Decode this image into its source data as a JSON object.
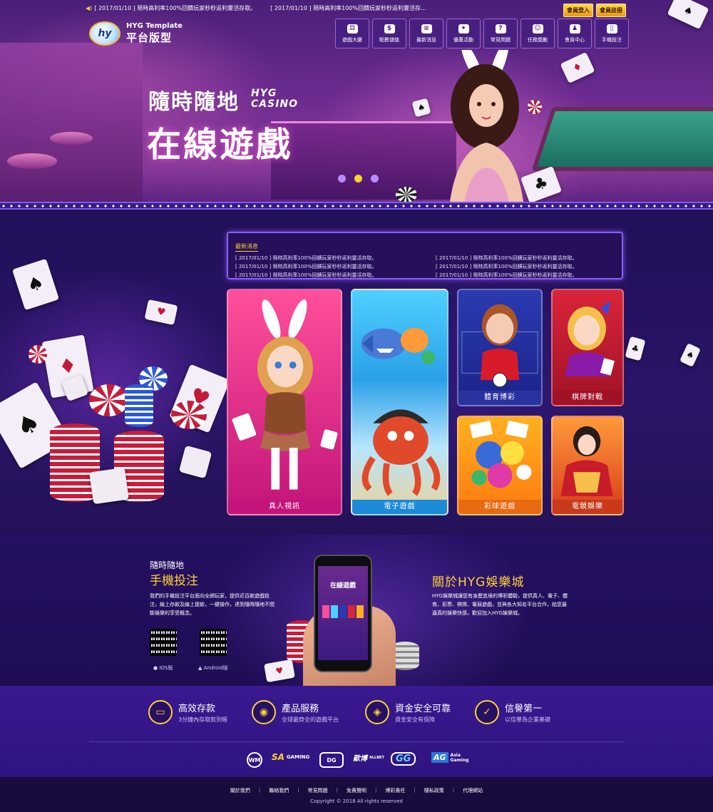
{
  "top_bar": {
    "ticker": [
      "[ 2017/01/10 ]  限時高利率100%回饋玩家秒秒返利靈活存取。",
      "[ 2017/01/10 ]  限時高利率100%回饋玩家秒秒返利靈活存..."
    ],
    "login_label": "會員登入",
    "register_label": "會員註冊"
  },
  "logo": {
    "mark": "hy",
    "line1": "HYG Template",
    "line2": "平台版型"
  },
  "nav": [
    {
      "label": "遊戲大廳",
      "icon": "dice-icon"
    },
    {
      "label": "點數儲值",
      "icon": "deposit-icon"
    },
    {
      "label": "最新消息",
      "icon": "news-icon"
    },
    {
      "label": "優惠活動",
      "icon": "gift-icon"
    },
    {
      "label": "常見問題",
      "icon": "question-icon"
    },
    {
      "label": "任務獎勵",
      "icon": "smile-icon"
    },
    {
      "label": "會員中心",
      "icon": "members-icon"
    },
    {
      "label": "手機投注",
      "icon": "phone-icon"
    }
  ],
  "hero": {
    "title1": "隨時隨地",
    "casino_line1": "HYG",
    "casino_line2": "CASINO",
    "title2": "在線遊戲",
    "slides": 3,
    "active_slide": 1
  },
  "news": {
    "title": "最新消息",
    "items": [
      "[ 2017/01/10 ]  限時高利率100%回饋玩家秒秒返利靈活存取。",
      "[ 2017/01/10 ]  限時高利率100%回饋玩家秒秒返利靈活存取。",
      "[ 2017/01/10 ]  限時高利率100%回饋玩家秒秒返利靈活存取。",
      "[ 2017/01/10 ]  限時高利率100%回饋玩家秒秒返利靈活存取。",
      "[ 2017/01/10 ]  限時高利率100%回饋玩家秒秒返利靈活存取。",
      "[ 2017/01/10 ]  限時高利率100%回饋玩家秒秒返利靈活存取。"
    ]
  },
  "games": {
    "live": "真人視訊",
    "slots": "電子遊戲",
    "sports": "體育博彩",
    "cards": "棋牌對戰",
    "lottery": "彩球遊戲",
    "esports": "電競娛樂"
  },
  "mobile": {
    "subtitle": "隨時隨地",
    "title": "手機投注",
    "description": "我們的手機投注平台面向全網玩家，提供近百款遊戲投注，線上存款及線上提款，一鍵操作，達到隨時隨地不間斷娛樂的享受概念。",
    "ios_label": "IOS版",
    "android_label": "Android版",
    "phone_screen_text": "在線遊戲"
  },
  "about": {
    "title": "關於HYG娛樂城",
    "description": "HYG娛樂城讓您有身歷其境的博彩體驗，提供真人、電子、體育、彩票、棋牌、電競遊戲，並與各大知名平台合作，給您最逼真的娛樂快感，歡迎加入HYG娛樂城。"
  },
  "features": [
    {
      "title": "高效存款",
      "subtitle": "3分鐘內存取款到帳",
      "icon": "card-icon"
    },
    {
      "title": "產品服務",
      "subtitle": "全球最齊全的遊戲平台",
      "icon": "globe-icon"
    },
    {
      "title": "資金安全可靠",
      "subtitle": "資金安全有保障",
      "icon": "shield-icon"
    },
    {
      "title": "信譽第一",
      "subtitle": "以信譽為企業基礎",
      "icon": "thumbs-up-icon"
    }
  ],
  "partners": {
    "wm": "WM",
    "sa_mark": "SA",
    "sa_text": "GAMING",
    "dg": "DG",
    "allbet": "歐博",
    "allbet_sub": "ALLBET",
    "gg": "GG",
    "ag_mark": "AG",
    "ag_text1": "Asia",
    "ag_text2": "Gaming"
  },
  "footer": {
    "links": [
      "關於我們",
      "聯絡我們",
      "常見問題",
      "免責聲明",
      "博彩責任",
      "隱私政策",
      "代理網站"
    ],
    "copyright": "Copyright © 2018 All rights reserved"
  },
  "colors": {
    "accent_gold": "#ffd233",
    "bg_deep_purple": "#1a0b3d",
    "news_border": "#8d5cff",
    "dot_active": "#ffd233",
    "dot_inactive": "#b58cff"
  }
}
